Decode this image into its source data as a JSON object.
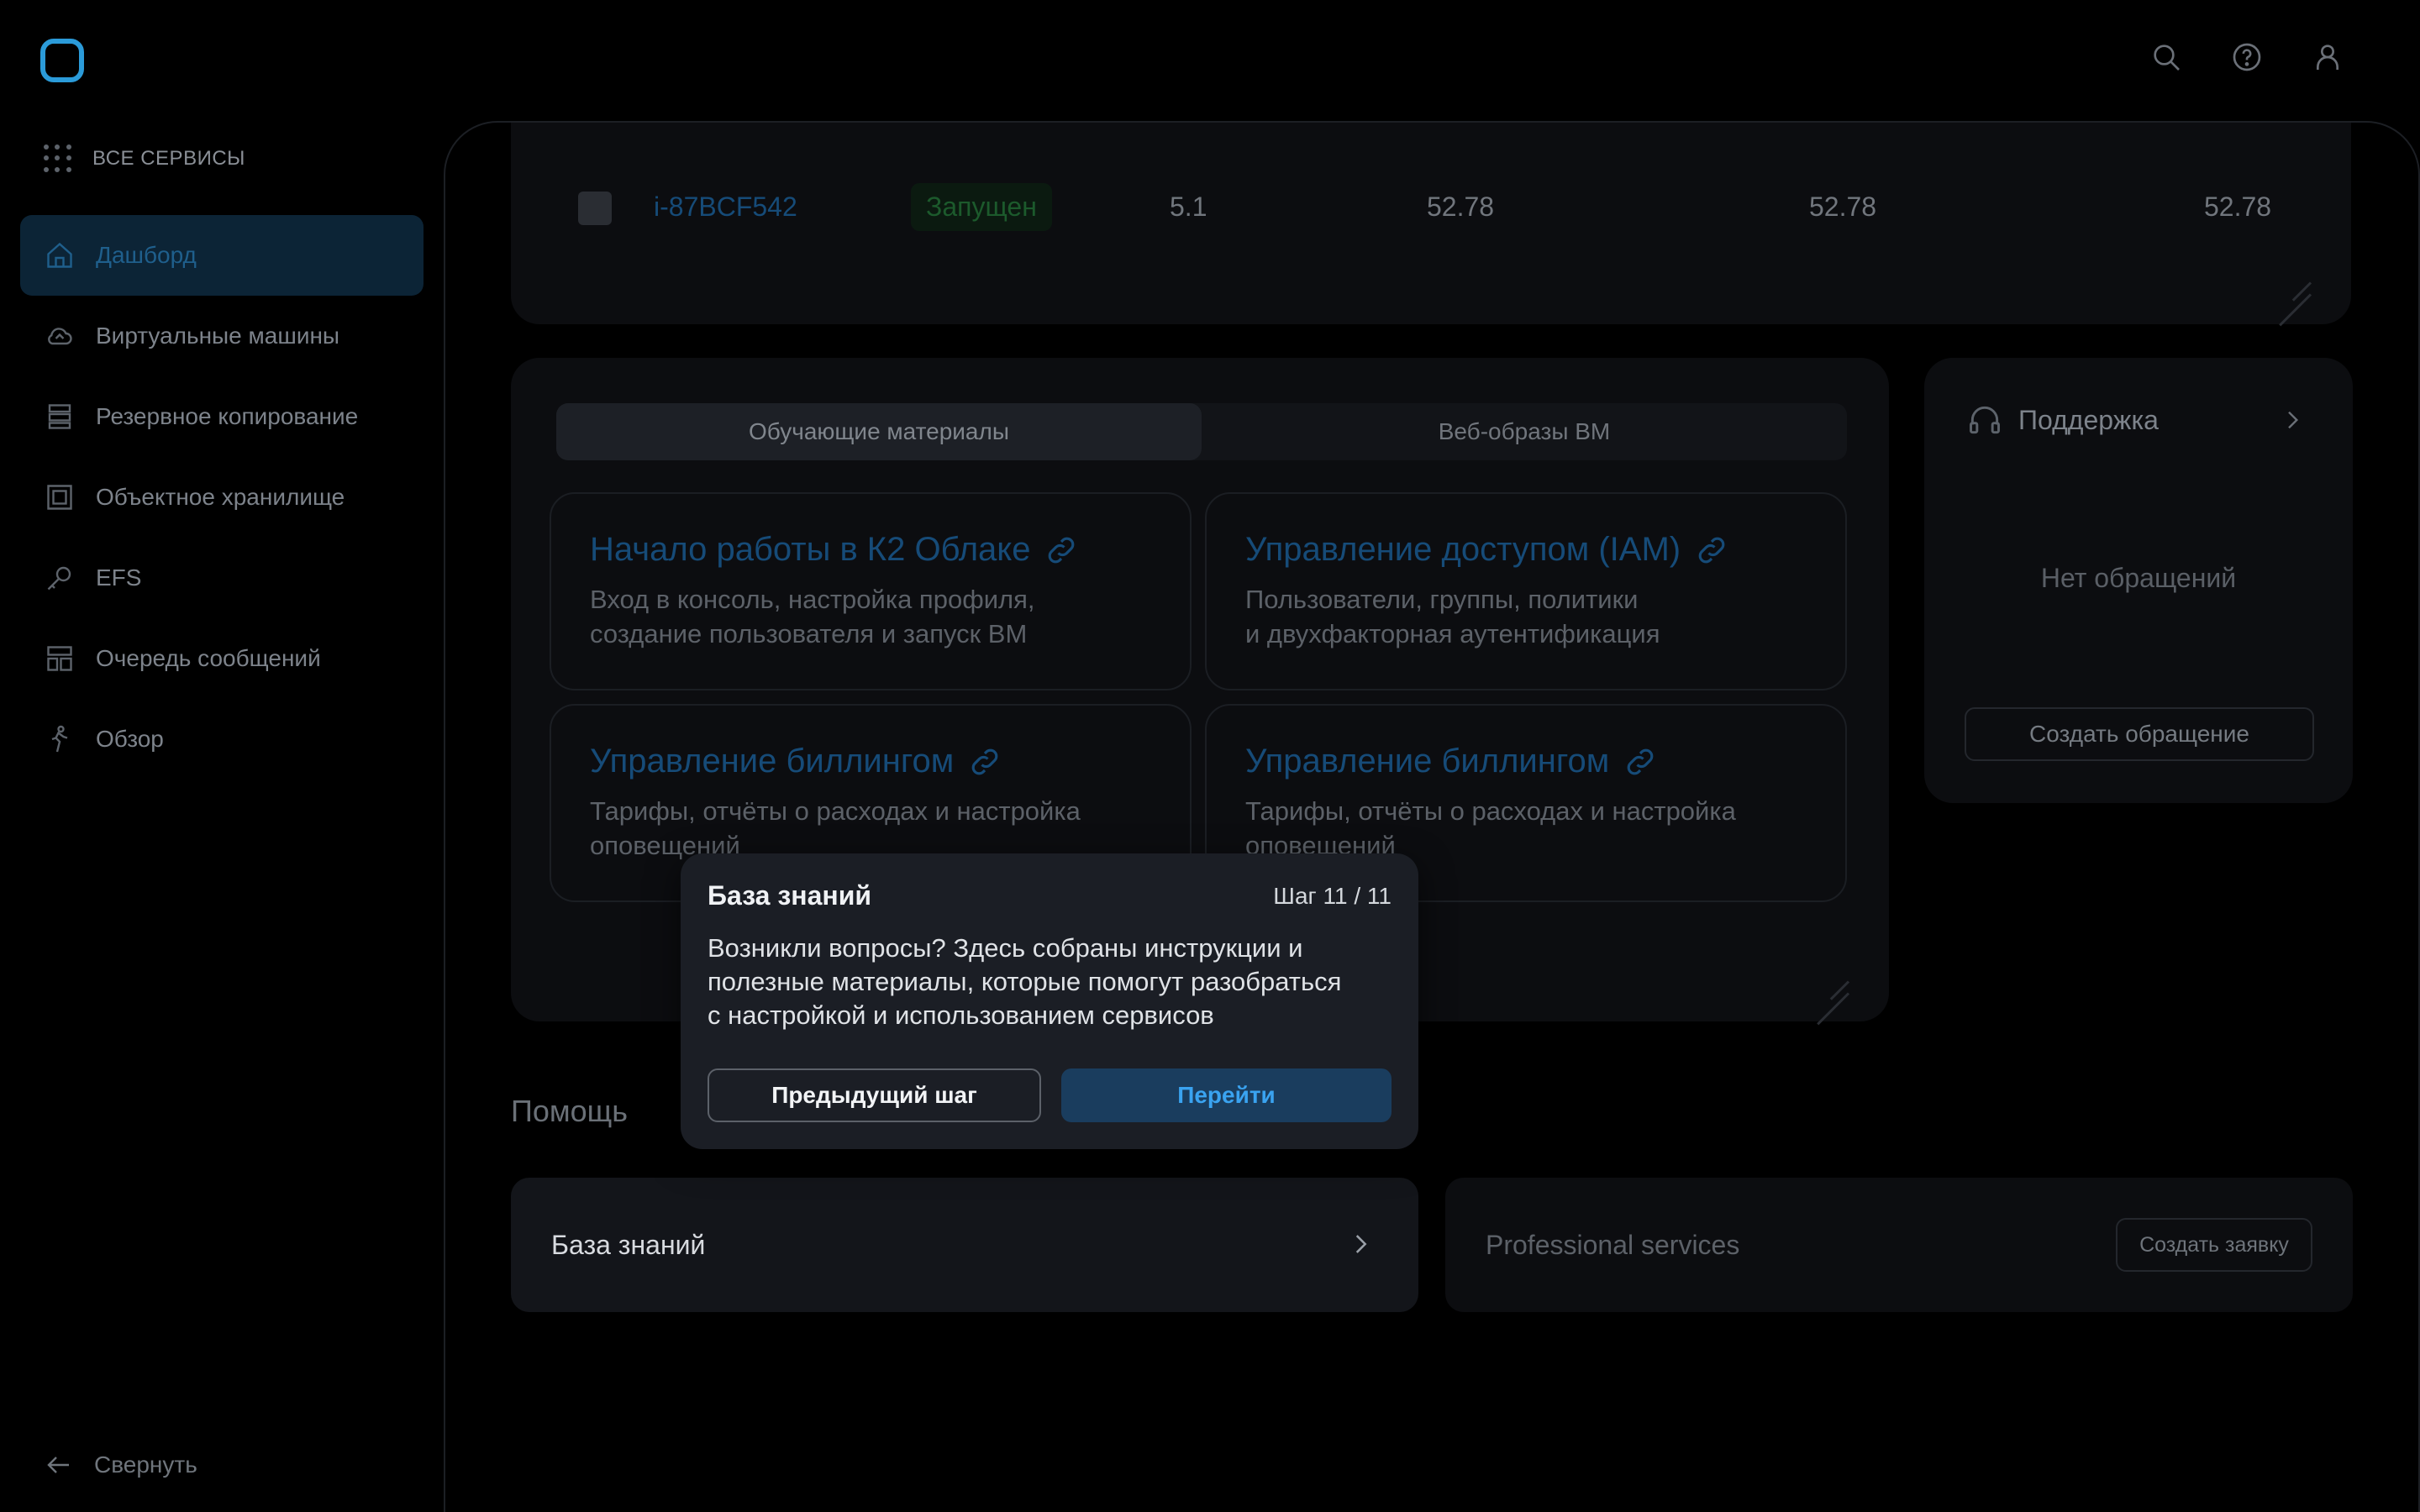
{
  "sidebar": {
    "all_services": "ВСЕ СЕРВИСЫ",
    "items": [
      {
        "label": "Дашборд",
        "icon": "home-icon",
        "active": true
      },
      {
        "label": "Виртуальные машины",
        "icon": "cloud-icon",
        "active": false
      },
      {
        "label": "Резервное копирование",
        "icon": "backup-icon",
        "active": false
      },
      {
        "label": "Объектное хранилище",
        "icon": "storage-icon",
        "active": false
      },
      {
        "label": "EFS",
        "icon": "efs-icon",
        "active": false
      },
      {
        "label": "Очередь сообщений",
        "icon": "queue-icon",
        "active": false
      },
      {
        "label": "Обзор",
        "icon": "tour-icon",
        "active": false
      }
    ],
    "collapse": "Свернуть"
  },
  "vm_table": {
    "row": {
      "id": "i-87BCF542",
      "status": "Запущен",
      "v1": "5.1",
      "v2": "52.78",
      "v3": "52.78",
      "v4": "52.78"
    }
  },
  "learning": {
    "tabs": [
      "Обучающие материалы",
      "Веб-образы ВМ"
    ],
    "active_tab": 0,
    "cards": [
      {
        "title": "Начало работы в К2 Облаке",
        "line1": "Вход в консоль, настройка профиля,",
        "line2": "создание пользователя и запуск ВМ"
      },
      {
        "title": "Управление доступом (IAM)",
        "line1": "Пользователи, группы, политики",
        "line2": "и двухфакторная аутентификация"
      },
      {
        "title": "Управление биллингом",
        "line1": "Тарифы, отчёты о расходах и настройка",
        "line2": "оповещений"
      },
      {
        "title": "Управление биллингом",
        "line1": "Тарифы, отчёты о расходах и настройка",
        "line2": "оповещений"
      }
    ]
  },
  "support": {
    "title": "Поддержка",
    "empty": "Нет обращений",
    "button": "Создать обращение"
  },
  "help": {
    "title": "Помощь",
    "knowledge_base": "База знаний",
    "professional_services": "Professional services",
    "create_request": "Создать заявку"
  },
  "tour": {
    "title": "База знаний",
    "step": "Шаг 11  / 11",
    "text": "Возникли вопросы? Здесь собраны инструкции и полезные материалы, которые помогут разобраться с настройкой и использованием сервисов",
    "prev": "Предыдущий шаг",
    "next": "Перейти"
  },
  "colors": {
    "accent": "#2b9bd9",
    "popover_bg": "#1b1e25",
    "primary_button": "#1a3d5e"
  }
}
